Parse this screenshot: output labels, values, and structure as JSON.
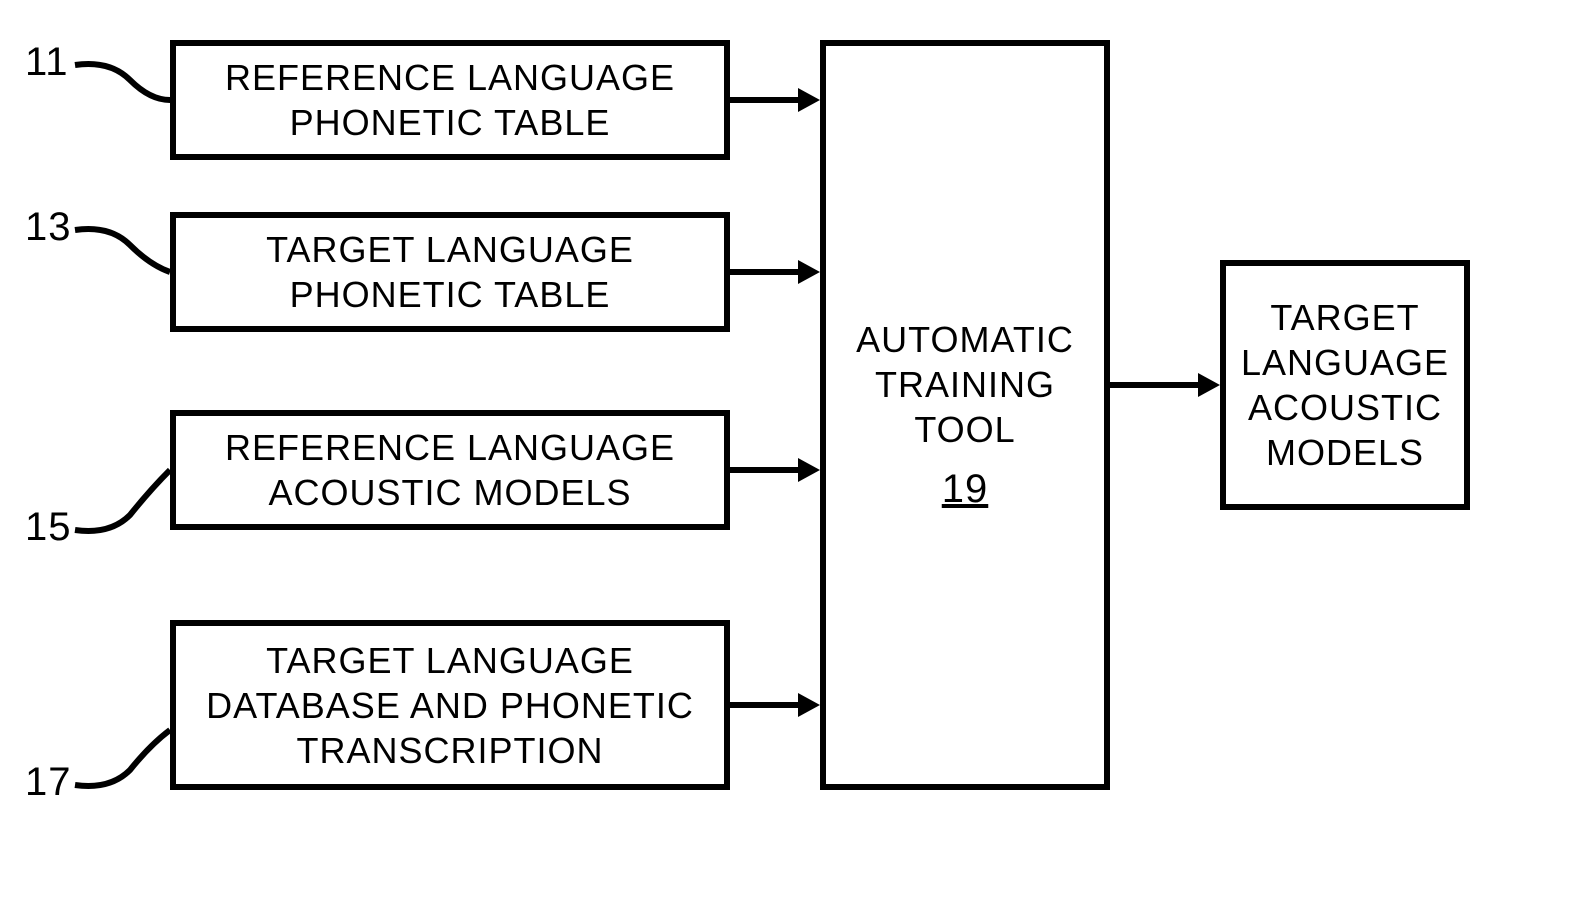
{
  "inputs": {
    "b11": {
      "num": "11",
      "line1": "REFERENCE LANGUAGE",
      "line2": "PHONETIC TABLE"
    },
    "b13": {
      "num": "13",
      "line1": "TARGET LANGUAGE",
      "line2": "PHONETIC TABLE"
    },
    "b15": {
      "num": "15",
      "line1": "REFERENCE LANGUAGE",
      "line2": "ACOUSTIC MODELS"
    },
    "b17": {
      "num": "17",
      "line1": "TARGET LANGUAGE",
      "line2": "DATABASE AND PHONETIC",
      "line3": "TRANSCRIPTION"
    }
  },
  "center": {
    "line1": "AUTOMATIC",
    "line2": "TRAINING",
    "line3": "TOOL",
    "refnum": "19"
  },
  "output": {
    "line1": "TARGET",
    "line2": "LANGUAGE",
    "line3": "ACOUSTIC",
    "line4": "MODELS"
  }
}
